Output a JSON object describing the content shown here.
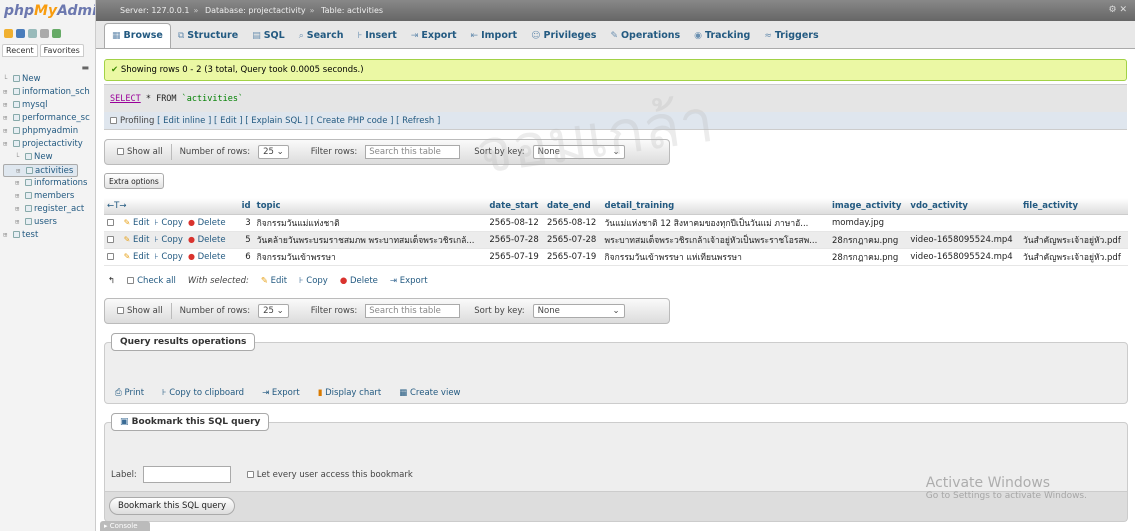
{
  "logo": {
    "php": "php",
    "my": "My",
    "admin": "Admin"
  },
  "nav": {
    "tabs": [
      "Recent",
      "Favorites"
    ],
    "tree": [
      {
        "label": "New",
        "level": 1
      },
      {
        "label": "information_sch",
        "level": 1
      },
      {
        "label": "mysql",
        "level": 1
      },
      {
        "label": "performance_sc",
        "level": 1
      },
      {
        "label": "phpmyadmin",
        "level": 1
      },
      {
        "label": "projectactivity",
        "level": 1
      },
      {
        "label": "New",
        "level": 2
      },
      {
        "label": "activities",
        "level": 2,
        "selected": true
      },
      {
        "label": "informations",
        "level": 2
      },
      {
        "label": "members",
        "level": 2
      },
      {
        "label": "register_act",
        "level": 2
      },
      {
        "label": "users",
        "level": 2
      },
      {
        "label": "test",
        "level": 1
      }
    ]
  },
  "serverbar": {
    "server": "Server: 127.0.0.1",
    "database": "Database: projectactivity",
    "table": "Table: activities"
  },
  "tabs": [
    {
      "label": "Browse",
      "icon": "browse-icon",
      "glyph": "▦",
      "active": true
    },
    {
      "label": "Structure",
      "icon": "structure-icon",
      "glyph": "⧉"
    },
    {
      "label": "SQL",
      "icon": "sql-icon",
      "glyph": "▤"
    },
    {
      "label": "Search",
      "icon": "search-icon",
      "glyph": "⌕"
    },
    {
      "label": "Insert",
      "icon": "insert-icon",
      "glyph": "⊦"
    },
    {
      "label": "Export",
      "icon": "export-icon",
      "glyph": "⇥"
    },
    {
      "label": "Import",
      "icon": "import-icon",
      "glyph": "⇤"
    },
    {
      "label": "Privileges",
      "icon": "privileges-icon",
      "glyph": "☺"
    },
    {
      "label": "Operations",
      "icon": "operations-icon",
      "glyph": "✎"
    },
    {
      "label": "Tracking",
      "icon": "tracking-icon",
      "glyph": "◉"
    },
    {
      "label": "Triggers",
      "icon": "triggers-icon",
      "glyph": "≈"
    }
  ],
  "success_msg": "Showing rows 0 - 2 (3 total, Query took 0.0005 seconds.)",
  "sql": {
    "select": "SELECT",
    "rest": " * FROM ",
    "table": "`activities`"
  },
  "profiling": {
    "label": "Profiling",
    "links": "[ Edit inline ] [ Edit ] [ Explain SQL ] [ Create PHP code ] [ Refresh ]"
  },
  "navbox": {
    "show_all": "Show all",
    "num_rows_label": "Number of rows:",
    "num_rows": "25",
    "filter_label": "Filter rows:",
    "filter_placeholder": "Search this table",
    "sortkey_label": "Sort by key:",
    "sortkey": "None"
  },
  "extra_options": "Extra options",
  "table": {
    "arrows": "←T→",
    "headers": [
      "id",
      "topic",
      "date_start",
      "date_end",
      "detail_training",
      "image_activity",
      "vdo_activity",
      "file_activity"
    ],
    "actions": {
      "edit": "Edit",
      "copy": "Copy",
      "delete": "Delete"
    },
    "rows": [
      {
        "id": "3",
        "topic": "กิจกรรมวันแม่แห่งชาติ",
        "date_start": "2565-08-12",
        "date_end": "2565-08-12",
        "detail_training": "วันแม่แห่งชาติ 12 สิงหาคมของทุกปีเป็นวันแม่ ภาษาอั...",
        "image_activity": "momday.jpg",
        "vdo_activity": "",
        "file_activity": ""
      },
      {
        "id": "5",
        "topic": "วันคล้ายวันพระบรมราชสมภพ พระบาทสมเด็จพระวชิรเกล้...",
        "date_start": "2565-07-28",
        "date_end": "2565-07-28",
        "detail_training": "พระบาทสมเด็จพระวชิรเกล้าเจ้าอยู่หัวเป็นพระราชโอรสพ...",
        "image_activity": "28กรกฎาคม.png",
        "vdo_activity": "video-1658095524.mp4",
        "file_activity": "วันสำคัญพระเจ้าอยู่หัว.pdf"
      },
      {
        "id": "6",
        "topic": "กิจกรรมวันเข้าพรรษา",
        "date_start": "2565-07-19",
        "date_end": "2565-07-19",
        "detail_training": "กิจกรรมวันเข้าพรรษา แห่เทียนพรรษา",
        "image_activity": "28กรกฎาคม.png",
        "vdo_activity": "video-1658095524.mp4",
        "file_activity": "วันสำคัญพระเจ้าอยู่หัว.pdf"
      }
    ]
  },
  "withsel": {
    "check_all": "Check all",
    "with_selected": "With selected:",
    "edit": "Edit",
    "copy": "Copy",
    "delete": "Delete",
    "export": "Export"
  },
  "qro": {
    "legend": "Query results operations",
    "print": "Print",
    "copy_clip": "Copy to clipboard",
    "export": "Export",
    "display_chart": "Display chart",
    "create_view": "Create view"
  },
  "bookmark": {
    "legend": "Bookmark this SQL query",
    "label": "Label:",
    "let_every": "Let every user access this bookmark",
    "button": "Bookmark this SQL query"
  },
  "console": "Console",
  "windows": {
    "title": "Activate Windows",
    "sub": "Go to Settings to activate Windows."
  },
  "watermark": "จอมเกล้า"
}
